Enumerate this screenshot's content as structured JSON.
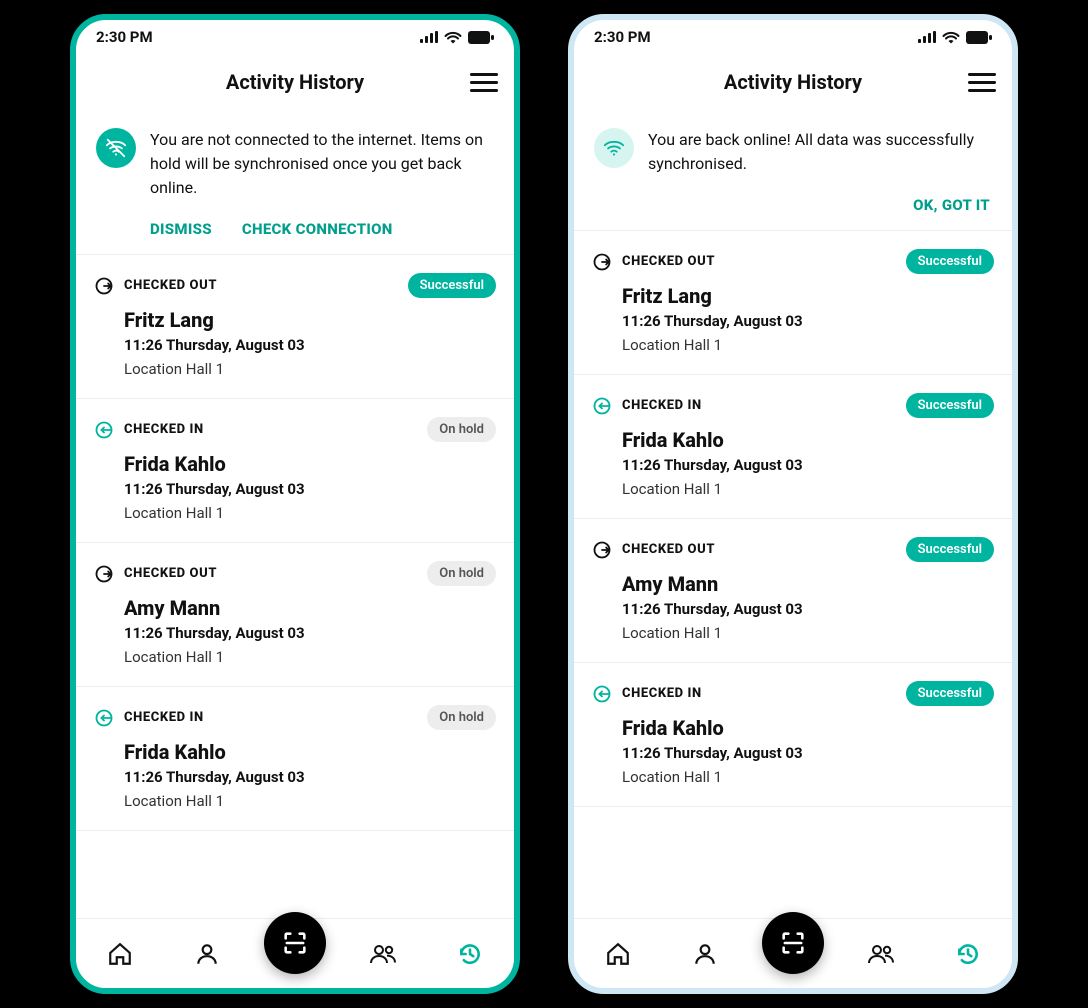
{
  "statusbar": {
    "time": "2:30 PM"
  },
  "header": {
    "title": "Activity History"
  },
  "banner_offline": {
    "text": "You are not connected to the internet. Items on hold will be synchronised once you get back online.",
    "dismiss": "DISMISS",
    "check": "CHECK CONNECTION"
  },
  "banner_online": {
    "text": "You are back online! All data was successfully synchronised.",
    "ok": "OK, GOT IT"
  },
  "status_labels": {
    "checked_out": "CHECKED OUT",
    "checked_in": "CHECKED IN",
    "successful": "Successful",
    "on_hold": "On hold"
  },
  "screens": {
    "offline": {
      "items": [
        {
          "dir": "out",
          "name": "Fritz Lang",
          "time": "11:26 Thursday, August 03",
          "loc": "Location Hall 1",
          "badge": "success"
        },
        {
          "dir": "in",
          "name": "Frida Kahlo",
          "time": "11:26 Thursday, August 03",
          "loc": "Location Hall 1",
          "badge": "hold"
        },
        {
          "dir": "out",
          "name": "Amy Mann",
          "time": "11:26 Thursday, August 03",
          "loc": "Location Hall 1",
          "badge": "hold"
        },
        {
          "dir": "in",
          "name": "Frida Kahlo",
          "time": "11:26 Thursday, August 03",
          "loc": "Location Hall 1",
          "badge": "hold"
        }
      ]
    },
    "online": {
      "items": [
        {
          "dir": "out",
          "name": "Fritz Lang",
          "time": "11:26 Thursday, August 03",
          "loc": "Location Hall 1",
          "badge": "success"
        },
        {
          "dir": "in",
          "name": "Frida Kahlo",
          "time": "11:26 Thursday, August 03",
          "loc": "Location Hall 1",
          "badge": "success"
        },
        {
          "dir": "out",
          "name": "Amy Mann",
          "time": "11:26 Thursday, August 03",
          "loc": "Location Hall 1",
          "badge": "success"
        },
        {
          "dir": "in",
          "name": "Frida Kahlo",
          "time": "11:26 Thursday, August 03",
          "loc": "Location Hall 1",
          "badge": "success"
        }
      ]
    }
  }
}
